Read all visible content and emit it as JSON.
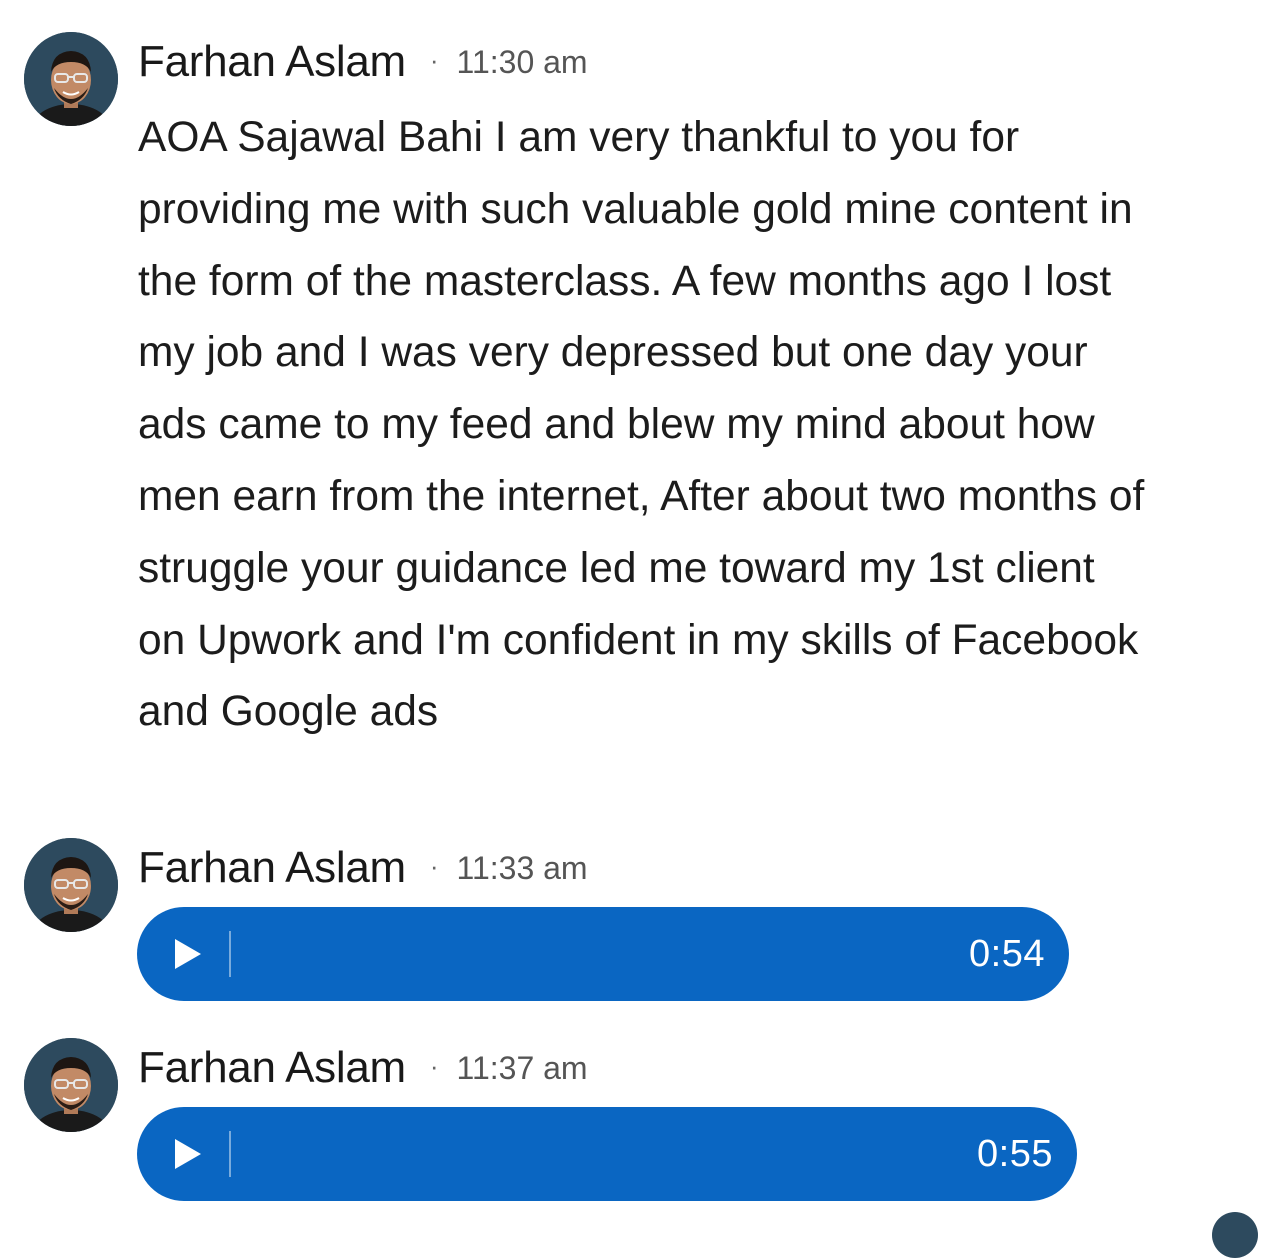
{
  "messages": [
    {
      "sender": "Farhan Aslam",
      "separator": "·",
      "time": "11:30 am",
      "type": "text",
      "text": "AOA Sajawal Bahi I am very thankful to you for providing me with such valuable gold mine content in the form of the masterclass. A few months ago I lost my job and I was very depressed but one day your ads came to my feed and blew my mind about how men earn from the internet, After about two months of struggle your guidance led me toward my 1st client on Upwork and I'm confident in my skills of Facebook and Google ads"
    },
    {
      "sender": "Farhan Aslam",
      "separator": "·",
      "time": "11:33 am",
      "type": "voice",
      "duration": "0:54",
      "icon": "play-icon"
    },
    {
      "sender": "Farhan Aslam",
      "separator": "·",
      "time": "11:37 am",
      "type": "voice",
      "duration": "0:55",
      "icon": "play-icon"
    }
  ],
  "colors": {
    "voice_bubble": "#0a66c2",
    "sender_text": "#191919",
    "time_text": "#555555",
    "avatar_bg": "#2d4a5e"
  }
}
